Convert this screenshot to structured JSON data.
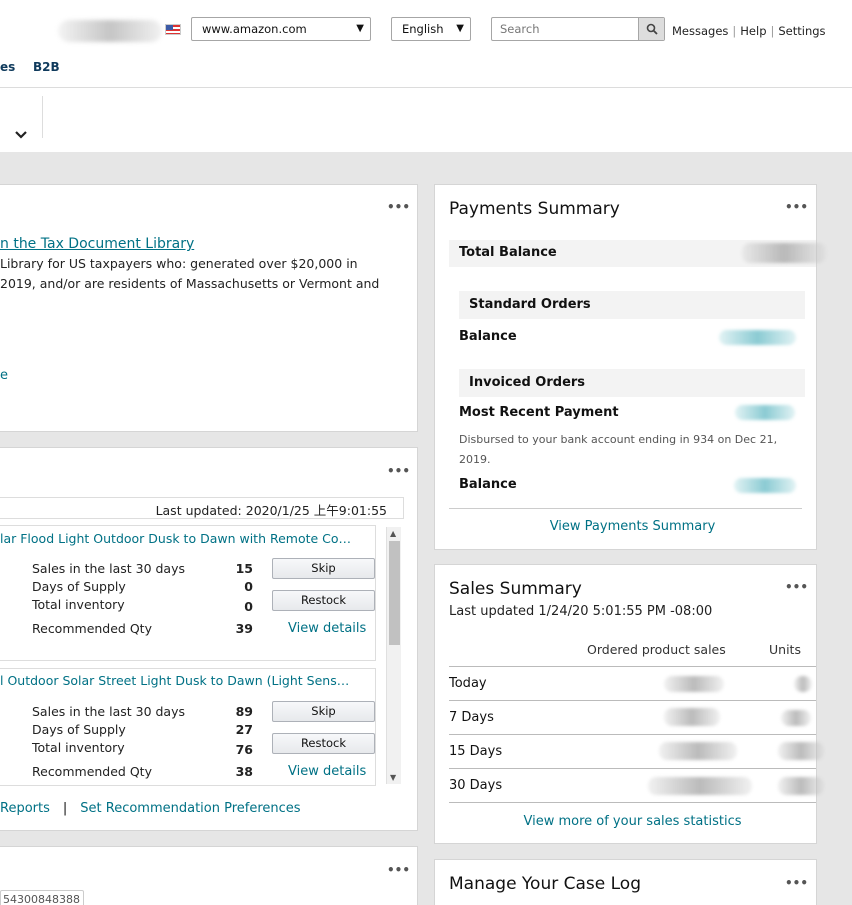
{
  "header": {
    "marketplace": "www.amazon.com",
    "language": "English",
    "search_placeholder": "Search",
    "links": [
      "Messages",
      "Help",
      "Settings"
    ],
    "nav": [
      "es",
      "B2B"
    ]
  },
  "tax_card": {
    "title": "n the Tax Document Library",
    "lines": [
      "Library for US taxpayers who: generated over $20,000 in",
      "2019, and/or are residents of Massachusetts or Vermont and"
    ],
    "link_fragment": "e"
  },
  "inventory_card": {
    "last_updated": "Last updated: 2020/1/25 上午9:01:55",
    "products": [
      {
        "title": "lar Flood Light Outdoor Dusk to Dawn with Remote Co…",
        "rows": [
          {
            "label": "Sales in the last 30 days",
            "value": "15"
          },
          {
            "label": "Days of Supply",
            "value": "0"
          },
          {
            "label": "Total inventory",
            "value": "0"
          },
          {
            "label": "Recommended Qty",
            "value": "39"
          }
        ],
        "btn1": "Skip",
        "btn2": "Restock",
        "link": "View details"
      },
      {
        "title": "l Outdoor Solar Street Light Dusk to Dawn (Light Sens…",
        "rows": [
          {
            "label": "Sales in the last 30 days",
            "value": "89"
          },
          {
            "label": "Days of Supply",
            "value": "27"
          },
          {
            "label": "Total inventory",
            "value": "76"
          },
          {
            "label": "Recommended Qty",
            "value": "38"
          }
        ],
        "btn1": "Skip",
        "btn2": "Restock",
        "link": "View details"
      }
    ],
    "footer_links": [
      "Reports",
      "Set Recommendation Preferences"
    ]
  },
  "case_card_left": {
    "id_fragment": "54300848388"
  },
  "payments": {
    "title": "Payments Summary",
    "total_balance": "Total Balance",
    "standard_orders": "Standard Orders",
    "balance1": "Balance",
    "invoiced_orders": "Invoiced Orders",
    "most_recent_payment": "Most Recent Payment",
    "note": "Disbursed to your bank account ending in 934 on Dec 21, 2019.",
    "balance2": "Balance",
    "view_link": "View Payments Summary"
  },
  "sales": {
    "title": "Sales Summary",
    "updated": "Last updated 1/24/20 5:01:55 PM -08:00",
    "col1": "Ordered product sales",
    "col2": "Units",
    "rows": [
      "Today",
      "7 Days",
      "15 Days",
      "30 Days"
    ],
    "view_link": "View more of your sales statistics"
  },
  "case_log": {
    "title": "Manage Your Case Log"
  },
  "menu_glyph": "•••",
  "chevron_glyph": "⌄"
}
